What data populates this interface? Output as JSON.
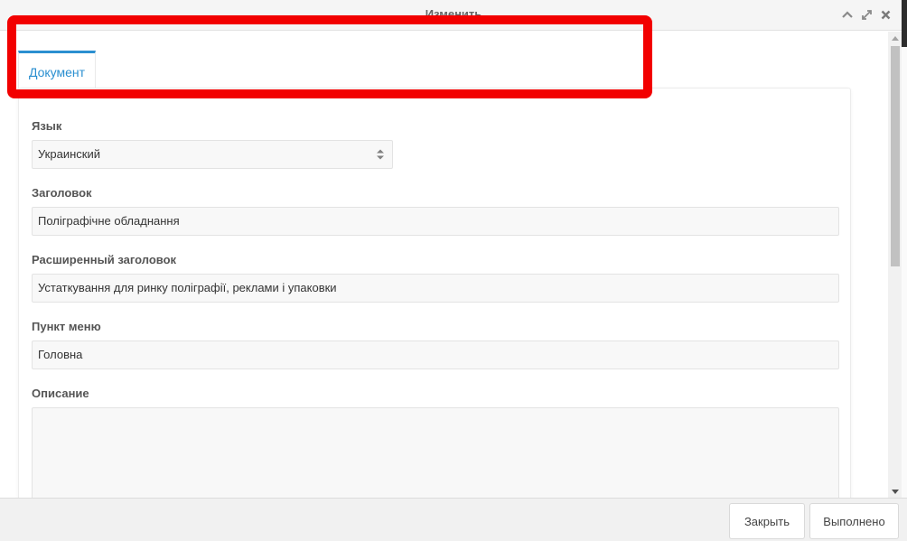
{
  "window": {
    "title": "Изменить",
    "controls": {
      "collapse_icon": "chevron-up-icon",
      "expand_icon": "expand-icon",
      "close_icon": "close-icon"
    }
  },
  "tabs": [
    {
      "label": "Документ",
      "active": true
    }
  ],
  "form": {
    "language": {
      "label": "Язык",
      "value": "Украинский"
    },
    "title": {
      "label": "Заголовок",
      "value": "Поліграфічне обладнання"
    },
    "extended_title": {
      "label": "Расширенный заголовок",
      "value": "Устаткування для ринку поліграфії, реклами і упаковки"
    },
    "menu_item": {
      "label": "Пункт меню",
      "value": "Головна"
    },
    "description": {
      "label": "Описание",
      "value": ""
    }
  },
  "footer": {
    "close_label": "Закрыть",
    "done_label": "Выполнено"
  },
  "colors": {
    "accent": "#2b8fd0",
    "highlight": "#f20000"
  }
}
